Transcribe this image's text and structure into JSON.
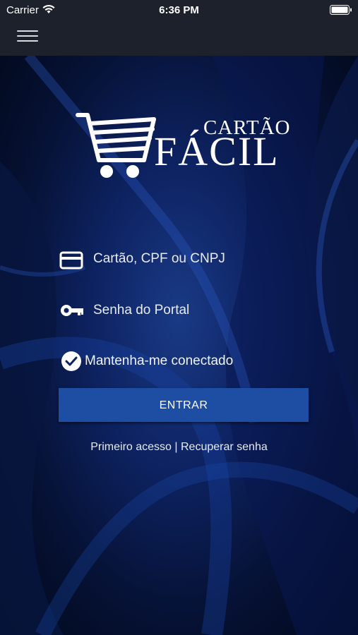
{
  "status": {
    "carrier": "Carrier",
    "time": "6:36 PM"
  },
  "logo": {
    "line1": "CARTÃO",
    "line2": "FÁCIL"
  },
  "form": {
    "card_placeholder": "Cartão, CPF ou CNPJ",
    "password_placeholder": "Senha do Portal",
    "remember_label": "Mantenha-me conectado",
    "submit_label": "ENTRAR"
  },
  "links": {
    "first_access": "Primeiro acesso",
    "separator": " | ",
    "recover": "Recuperar senha"
  },
  "colors": {
    "bar": "#1d212c",
    "button": "#1d4ea3",
    "background": "#0d2260"
  }
}
